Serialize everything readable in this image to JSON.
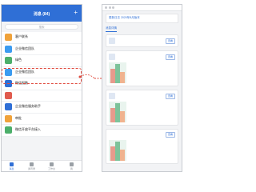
{
  "left": {
    "header_title": "消息 (84)",
    "search_placeholder": "搜索",
    "rows": [
      {
        "name": "客户联系",
        "sub": "",
        "time": "",
        "color": "#f0a23a"
      },
      {
        "name": "企业微信团队",
        "sub": "",
        "time": "",
        "color": "#3b9bf0"
      },
      {
        "name": "绿色",
        "sub": "",
        "time": "",
        "color": "#4caf6a"
      },
      {
        "name": "企业微信团队",
        "sub": "",
        "time": "",
        "color": "#3b9bf0"
      },
      {
        "name": "微信报数",
        "sub": "",
        "time": "",
        "color": "#2f6fd6"
      },
      {
        "name": "",
        "sub": "",
        "time": "",
        "color": "#e05b4e"
      },
      {
        "name": "企业微信服务助手",
        "sub": "",
        "time": "",
        "color": "#2f6fd6"
      },
      {
        "name": "审批",
        "sub": "",
        "time": "",
        "color": "#f0a23a"
      },
      {
        "name": "微信开放平台接入",
        "sub": "",
        "time": "",
        "color": "#4caf6a"
      }
    ],
    "tabs": [
      {
        "label": "消息"
      },
      {
        "label": "通讯录"
      },
      {
        "label": "工作台"
      },
      {
        "label": "我"
      }
    ]
  },
  "right": {
    "notice_line1": "更新日志 2020年8月版本",
    "notice_line2": "",
    "tabs": [
      {
        "label": "消息详情"
      },
      {
        "label": ""
      }
    ],
    "cards": [
      {
        "name": "",
        "button": "查看"
      },
      {
        "name": "",
        "button": "查看"
      },
      {
        "name": "",
        "button": "查看"
      },
      {
        "name": "",
        "button": "查看"
      }
    ],
    "footer_button": "查看"
  },
  "colors": {
    "brand_blue": "#2f6fd6",
    "highlight_red": "#e04b3f"
  }
}
